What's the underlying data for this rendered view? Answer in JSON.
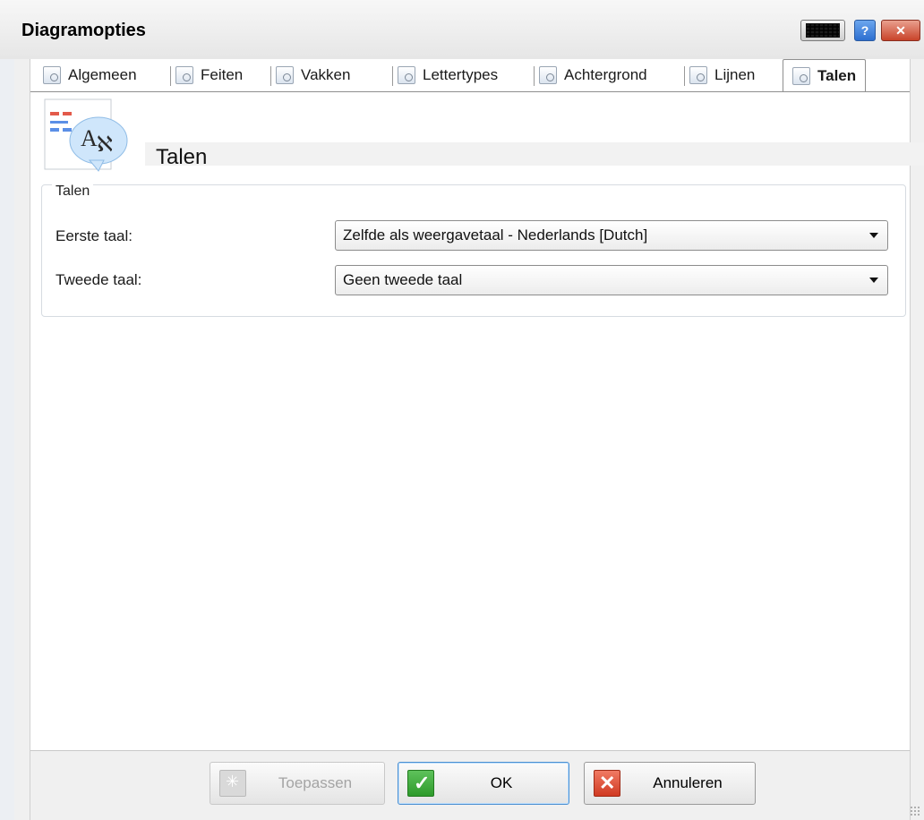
{
  "window": {
    "title": "Diagramopties"
  },
  "tabs": [
    {
      "label": "Algemeen"
    },
    {
      "label": "Feiten"
    },
    {
      "label": "Vakken"
    },
    {
      "label": "Lettertypes"
    },
    {
      "label": "Achtergrond"
    },
    {
      "label": "Lijnen"
    },
    {
      "label": "Talen"
    }
  ],
  "active_tab": "Talen",
  "header": {
    "title": "Talen"
  },
  "group": {
    "legend": "Talen",
    "first_language": {
      "label": "Eerste taal:",
      "value": "Zelfde als weergavetaal - Nederlands [Dutch]"
    },
    "second_language": {
      "label": "Tweede taal:",
      "value": "Geen tweede taal"
    }
  },
  "footer": {
    "apply_label": "Toepassen",
    "ok_label": "OK",
    "cancel_label": "Annuleren"
  },
  "colors": {
    "ok_icon": "#2e9a2b",
    "cancel_icon": "#d03a22",
    "help_button": "#2d6fd0",
    "close_button": "#c9432a"
  }
}
